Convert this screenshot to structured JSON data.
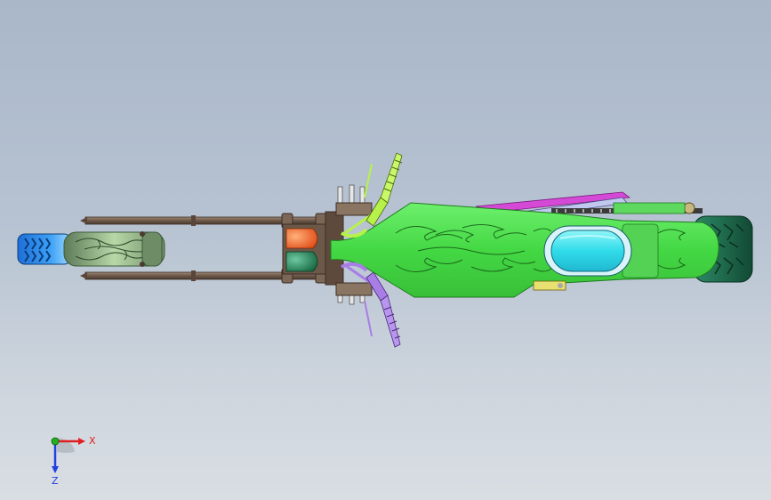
{
  "viewport": {
    "background_top": "#a9b7c9",
    "background_bottom": "#d9dee3"
  },
  "model": {
    "parts": [
      "front-tire-blue",
      "front-wheel-green",
      "fork-tubes",
      "triple-clamp",
      "headlight-orange",
      "headlight-green",
      "handlebar-grip-lime",
      "handlebar-grip-purple",
      "frame-green-flames",
      "fuel-tank-cyan",
      "seat-magenta",
      "exhaust-pipe",
      "rear-tire-dark-green"
    ],
    "colors": {
      "frame": "#4ee04e",
      "tank": "#38e6ec",
      "front_tire": "#2a84e8",
      "rear_tire": "#1e6e4e",
      "fork": "#7c6656",
      "lime_grip": "#b6f24a",
      "purple_grip": "#a87ee6",
      "seat": "#d44ad6",
      "headlight_orange": "#f05a1e",
      "headlight_green": "#1e8a5a"
    }
  },
  "triad": {
    "x_label": "X",
    "z_label": "Z",
    "x_color": "#e02020",
    "y_color": "#20b020",
    "z_color": "#2040e0"
  }
}
